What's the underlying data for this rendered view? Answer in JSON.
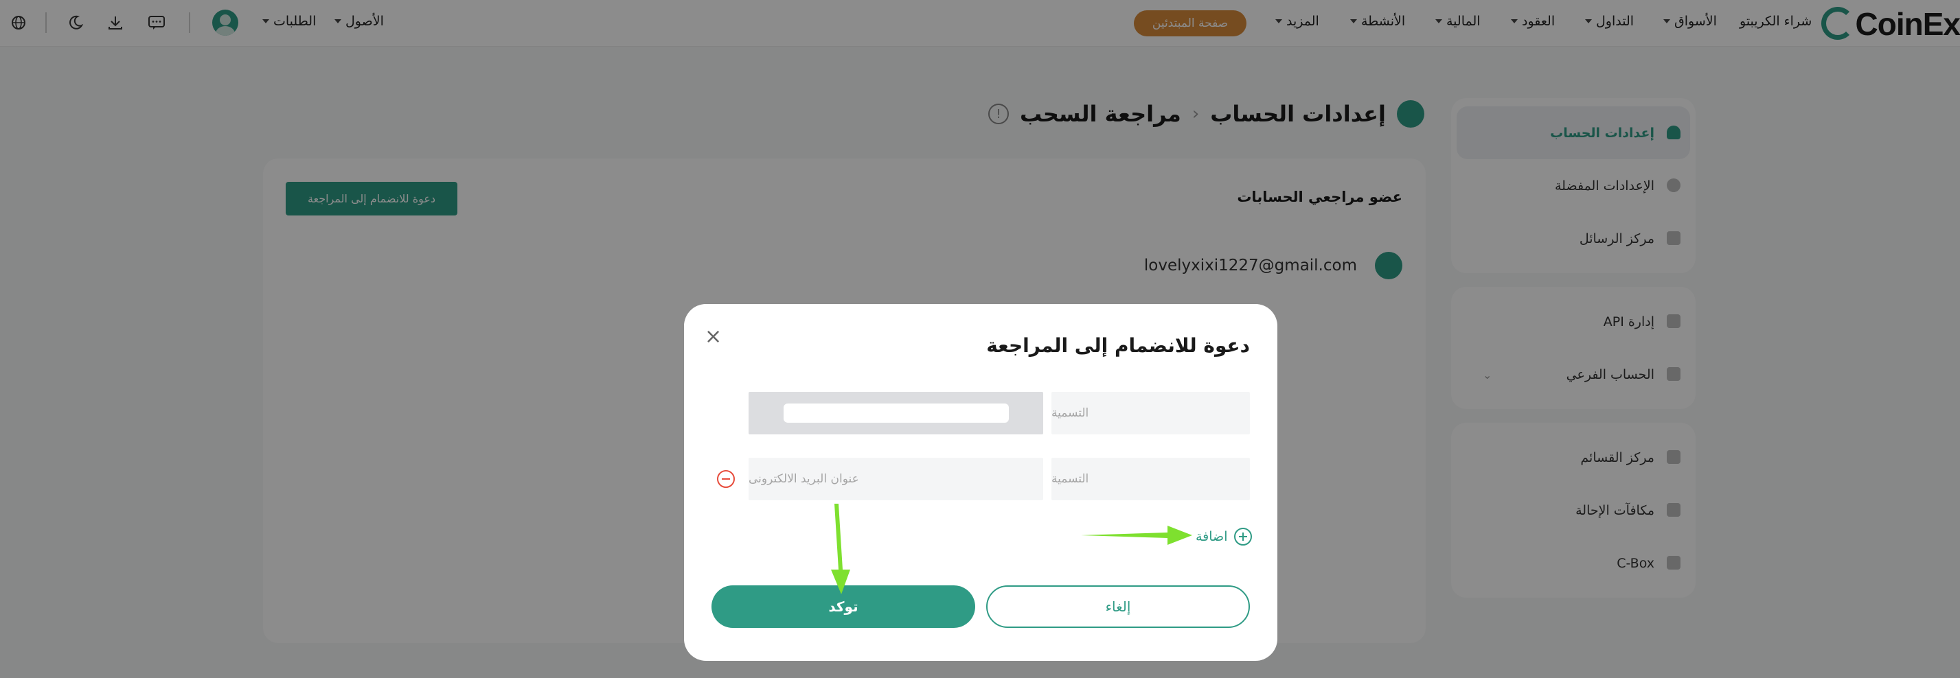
{
  "brand": {
    "name": "CoinEx"
  },
  "topnav": {
    "buy_crypto": "شراء الكريبتو",
    "markets": "الأسواق",
    "trading": "التداول",
    "contracts": "العقود",
    "finance": "المالية",
    "activities": "الأنشطة",
    "more": "المزيد",
    "beginner_page": "صفحة المبتدئين",
    "assets": "الأصول",
    "orders": "الطلبات",
    "icons": [
      "message-icon",
      "download-icon",
      "moon-icon",
      "globe-icon"
    ]
  },
  "sidebar": {
    "group1": [
      {
        "label": "إعدادات الحساب",
        "icon": "user-icon",
        "active": true
      },
      {
        "label": "الإعدادات المفضلة",
        "icon": "leaf-icon"
      },
      {
        "label": "مركز الرسائل",
        "icon": "mail-icon"
      }
    ],
    "group2": [
      {
        "label": "إدارة API",
        "icon": "grid-icon"
      },
      {
        "label": "الحساب الفرعي",
        "icon": "subaccount-icon"
      }
    ],
    "group3": [
      {
        "label": "مركز القسائم",
        "icon": "coupon-icon"
      },
      {
        "label": "مكافآت الإحالة",
        "icon": "gift-icon"
      },
      {
        "label": "C-Box",
        "icon": "box-icon"
      }
    ]
  },
  "breadcrumb": {
    "parent": "إعدادات الحساب",
    "separator": "‹",
    "current": "مراجعة السحب"
  },
  "main": {
    "section_title": "عضو مراجعي الحسابات",
    "invite_button": "دعوة للانضمام إلى المراجعة",
    "member_email": "lovelyxixi1227@gmail.com"
  },
  "modal": {
    "title": "دعوة للانضمام إلى المراجعة",
    "rows": [
      {
        "label_placeholder": "التسمية",
        "email_placeholder": ""
      },
      {
        "label_placeholder": "التسمية",
        "email_placeholder": "عنوان البريد الالكترونى"
      }
    ],
    "add_label": "اضافة",
    "cancel_label": "إلغاء",
    "confirm_label": "توكد",
    "close_glyph": "×"
  },
  "colors": {
    "accent": "#2f9b85",
    "beginner": "#d88b3b",
    "danger": "#e74c3c",
    "annotation_arrow": "#7ee02f"
  }
}
